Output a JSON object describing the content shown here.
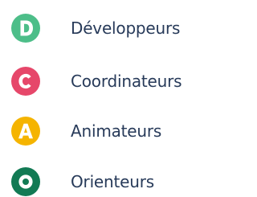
{
  "legend": {
    "items": [
      {
        "letter": "D",
        "label": "Développeurs",
        "color": "#4dbe89",
        "icon": "letter-d-badge-icon"
      },
      {
        "letter": "C",
        "label": "Coordinateurs",
        "color": "#e6476a",
        "icon": "letter-c-badge-icon"
      },
      {
        "letter": "A",
        "label": "Animateurs",
        "color": "#f5b400",
        "icon": "letter-a-badge-icon"
      },
      {
        "letter": "O",
        "label": "Orienteurs",
        "color": "#127a54",
        "icon": "letter-o-badge-icon"
      }
    ]
  }
}
